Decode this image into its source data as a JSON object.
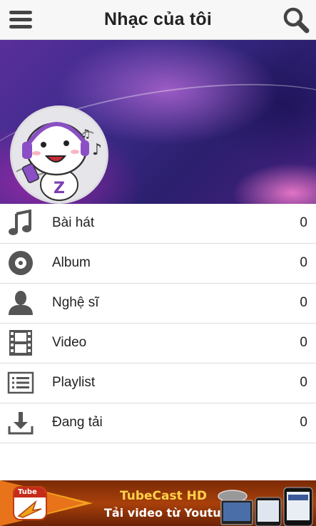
{
  "header": {
    "title": "Nhạc của tôi",
    "menu_icon": "hamburger-menu-icon",
    "search_icon": "search-icon"
  },
  "banner": {
    "avatar_icon": "zing-mascot-avatar"
  },
  "library": [
    {
      "key": "songs",
      "label": "Bài hát",
      "count": "0",
      "icon": "music-note-icon"
    },
    {
      "key": "album",
      "label": "Album",
      "count": "0",
      "icon": "disc-icon"
    },
    {
      "key": "artist",
      "label": "Nghệ sĩ",
      "count": "0",
      "icon": "person-icon"
    },
    {
      "key": "video",
      "label": "Video",
      "count": "0",
      "icon": "film-icon"
    },
    {
      "key": "playlist",
      "label": "Playlist",
      "count": "0",
      "icon": "list-icon"
    },
    {
      "key": "downloading",
      "label": "Đang tải",
      "count": "0",
      "icon": "download-icon"
    }
  ],
  "ad": {
    "title": "TubeCast HD",
    "subtitle": "Tải video từ Youtube",
    "logo_text": "Tube",
    "colors": {
      "background": "#a9400b",
      "title": "#ffd24a",
      "arrow": "#f2a11e"
    }
  },
  "colors": {
    "icon": "#555555",
    "topbar": "#f7f7f7",
    "divider": "#dcdcdc"
  }
}
